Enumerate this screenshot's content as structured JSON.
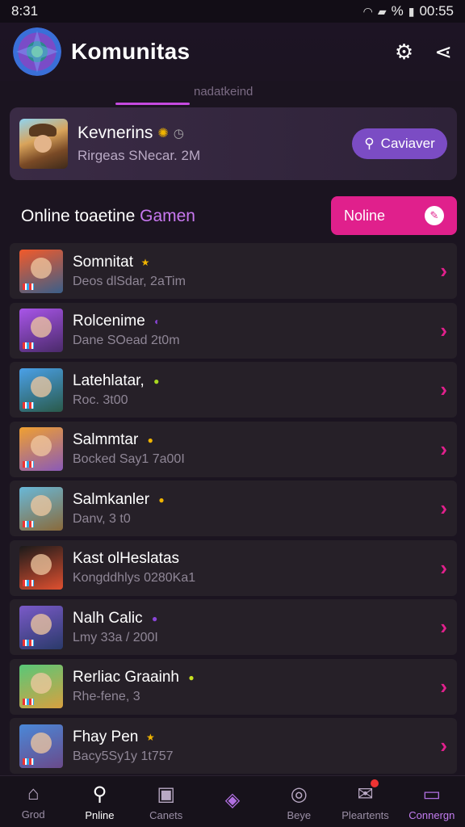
{
  "status": {
    "time": "8:31",
    "battery": "%",
    "right_time": "00:55"
  },
  "header": {
    "title": "Komunitas"
  },
  "tabs": {
    "faint_label": "nadatkeind"
  },
  "profile": {
    "name": "Kevnerins",
    "subtitle": "Rirgeas SNecar. 2M",
    "search_label": "Caviaver"
  },
  "section": {
    "title_main": "Online toaetine ",
    "title_accent": "Gamen",
    "online_button": "Noline"
  },
  "rows": [
    {
      "title": "Somnitat",
      "subtitle": "Deos dlSdar, 2aTim",
      "badge": "★",
      "badge_color": "#f0b400",
      "thumb_colors": [
        "#f25a2a",
        "#3a5f8a"
      ]
    },
    {
      "title": "Rolcenime",
      "subtitle": "Dane SOead 2t0m",
      "badge": "◐",
      "badge_color": "#8a45d8",
      "thumb_colors": [
        "#a855e8",
        "#4a2a6a"
      ]
    },
    {
      "title": "Latehlatar,",
      "subtitle": "Roc. 3t00",
      "badge": "●",
      "badge_color": "#a8d820",
      "thumb_colors": [
        "#4aa0e8",
        "#2a5a4a"
      ]
    },
    {
      "title": "Salmmtar",
      "subtitle": "Bocked Say1 7a00I",
      "badge": "●",
      "badge_color": "#f0b400",
      "thumb_colors": [
        "#f0a030",
        "#8a5ab8"
      ]
    },
    {
      "title": "Salmkanler",
      "subtitle": "Danv, 3 t0",
      "badge": "●",
      "badge_color": "#f0b400",
      "thumb_colors": [
        "#68b8d8",
        "#8a6a3a"
      ]
    },
    {
      "title": "Kast olHeslatas",
      "subtitle": "Kongddhlys 0280Ka1",
      "badge": "",
      "badge_color": "#000000",
      "thumb_colors": [
        "#1a1a1a",
        "#e05030"
      ]
    },
    {
      "title": "Nalh Calic",
      "subtitle": "Lmy 33a / 200I",
      "badge": "●",
      "badge_color": "#8a45d8",
      "thumb_colors": [
        "#7a5ac8",
        "#2a3a6a"
      ]
    },
    {
      "title": "Rerliac Graainh",
      "subtitle": "Rhe-fene, 3",
      "badge": "●",
      "badge_color": "#c8e020",
      "thumb_colors": [
        "#58c878",
        "#d8a040"
      ]
    },
    {
      "title": "Fhay Pen",
      "subtitle": "Bacy5Sy1y 1t757",
      "badge": "★",
      "badge_color": "#f0b400",
      "thumb_colors": [
        "#4a88d8",
        "#6a4a8a"
      ]
    }
  ],
  "bottom_nav": [
    {
      "label": "Grod",
      "icon": "home-icon",
      "glyph": "⌂"
    },
    {
      "label": "Pnline",
      "icon": "search-icon",
      "glyph": "⚲"
    },
    {
      "label": "Canets",
      "icon": "card-icon",
      "glyph": "▣"
    },
    {
      "label": "",
      "icon": "compass-icon",
      "glyph": "◈"
    },
    {
      "label": "Beye",
      "icon": "shield-icon",
      "glyph": "◎"
    },
    {
      "label": "Pleartents",
      "icon": "mail-icon",
      "glyph": "✉"
    },
    {
      "label": "Connergn",
      "icon": "chat-icon",
      "glyph": "▭"
    }
  ]
}
